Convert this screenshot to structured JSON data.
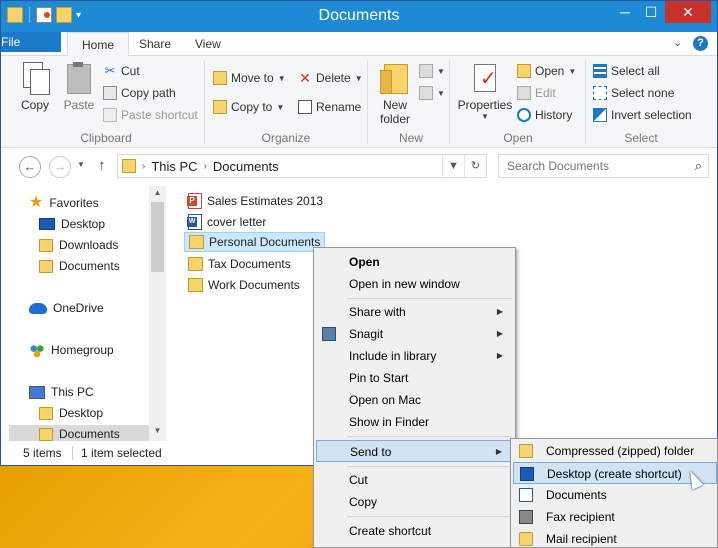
{
  "window": {
    "title": "Documents"
  },
  "titlebar": {
    "minimize": "─",
    "maximize": "☐",
    "close": "✕"
  },
  "tabs": {
    "file": "File",
    "home": "Home",
    "share": "Share",
    "view": "View",
    "help": "?"
  },
  "ribbon": {
    "clipboard": {
      "label": "Clipboard",
      "copy": "Copy",
      "paste": "Paste",
      "cut": "Cut",
      "copy_path": "Copy path",
      "paste_shortcut": "Paste shortcut"
    },
    "organize": {
      "label": "Organize",
      "move_to": "Move to",
      "copy_to": "Copy to",
      "delete": "Delete",
      "rename": "Rename"
    },
    "new": {
      "label": "New",
      "new_folder_line1": "New",
      "new_folder_line2": "folder"
    },
    "open": {
      "label": "Open",
      "properties": "Properties",
      "open": "Open",
      "edit": "Edit",
      "history": "History"
    },
    "select": {
      "label": "Select",
      "select_all": "Select all",
      "select_none": "Select none",
      "invert": "Invert selection"
    }
  },
  "address": {
    "path": [
      "This PC",
      "Documents"
    ],
    "search_placeholder": "Search Documents"
  },
  "navpane": {
    "favorites": "Favorites",
    "desktop": "Desktop",
    "downloads": "Downloads",
    "documents": "Documents",
    "onedrive": "OneDrive",
    "homegroup": "Homegroup",
    "thispc": "This PC",
    "pc_desktop": "Desktop",
    "pc_documents": "Documents"
  },
  "files": [
    {
      "name": "Sales Estimates 2013",
      "type": "ppt"
    },
    {
      "name": "cover letter",
      "type": "doc"
    },
    {
      "name": "Personal Documents",
      "type": "folder"
    },
    {
      "name": "Tax Documents",
      "type": "folder"
    },
    {
      "name": "Work Documents",
      "type": "folder"
    }
  ],
  "status": {
    "items": "5 items",
    "selected": "1 item selected"
  },
  "context_menu": {
    "open": "Open",
    "open_new": "Open in new window",
    "share_with": "Share with",
    "snagit": "Snagit",
    "include_library": "Include in library",
    "pin_start": "Pin to Start",
    "open_mac": "Open on Mac",
    "show_finder": "Show in Finder",
    "send_to": "Send to",
    "cut": "Cut",
    "copy": "Copy",
    "create_shortcut": "Create shortcut"
  },
  "send_to_menu": {
    "compressed": "Compressed (zipped) folder",
    "desktop": "Desktop (create shortcut)",
    "documents": "Documents",
    "fax": "Fax recipient",
    "mail": "Mail recipient"
  }
}
